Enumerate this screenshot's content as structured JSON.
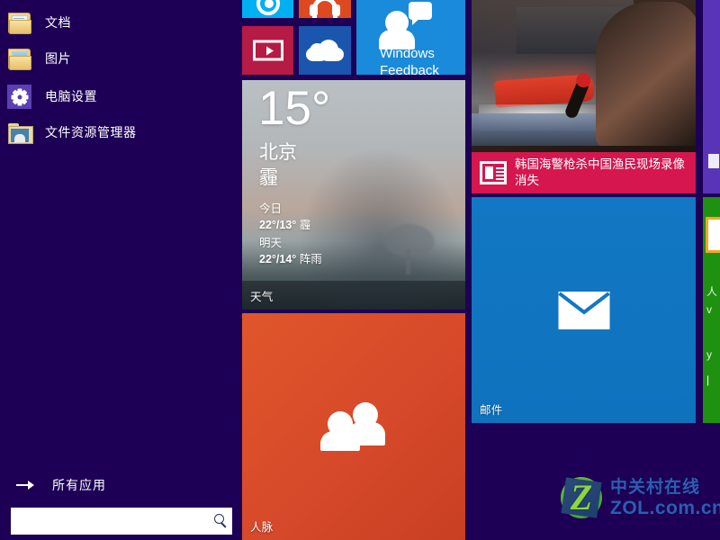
{
  "screen": {
    "background_color": "#1d0055",
    "os": "Windows 8.1 Start Screen"
  },
  "sidebar": {
    "items": [
      {
        "label": "文档",
        "icon": "folder-documents-icon"
      },
      {
        "label": "图片",
        "icon": "folder-pictures-icon"
      },
      {
        "label": "电脑设置",
        "icon": "gear-settings-icon"
      },
      {
        "label": "文件资源管理器",
        "icon": "file-explorer-icon"
      }
    ],
    "all_apps": {
      "label": "所有应用",
      "icon": "arrow-right-icon"
    },
    "search": {
      "value": "",
      "placeholder": "",
      "icon": "search-icon"
    }
  },
  "tiles": {
    "cyan": {
      "label": "",
      "icon": "camera-icon",
      "color": "#00b0f0"
    },
    "music": {
      "label": "",
      "icon": "headphones-icon",
      "color": "#dd4a22"
    },
    "video": {
      "label": "",
      "icon": "video-play-icon",
      "color": "#b51b45"
    },
    "skydrive": {
      "label": "",
      "icon": "onedrive-cloud-icon",
      "color": "#1a56ad"
    },
    "feedback": {
      "line1": "Windows",
      "line2": "Feedback",
      "icon": "person-speech-bubble-icon",
      "color": "#1a8ada"
    },
    "weather": {
      "temperature": "15°",
      "city": "北京",
      "condition": "霾",
      "today_label": "今日",
      "today_range": "22°/13°",
      "today_cond": "霾",
      "tomorrow_label": "明天",
      "tomorrow_range": "22°/14°",
      "tomorrow_cond": "阵雨",
      "label": "天气"
    },
    "people": {
      "label": "人脉",
      "icon": "people-icon",
      "color": "#d6492a"
    },
    "news": {
      "headline": "韩国海警枪杀中国渔民现场录像消失",
      "icon": "news-article-icon",
      "strip_color": "#d5164f"
    },
    "mail": {
      "label": "邮件",
      "icon": "envelope-icon",
      "color": "#0f72bd"
    },
    "purple_edge": {
      "label": "",
      "color": "#5a34b8"
    },
    "green_edge": {
      "label": "",
      "color": "#1f9110"
    }
  },
  "watermark": {
    "cn": "中关村在线",
    "en": "ZOL.com.cn",
    "logo_letter": "Z",
    "color": "#2a5fb0"
  }
}
